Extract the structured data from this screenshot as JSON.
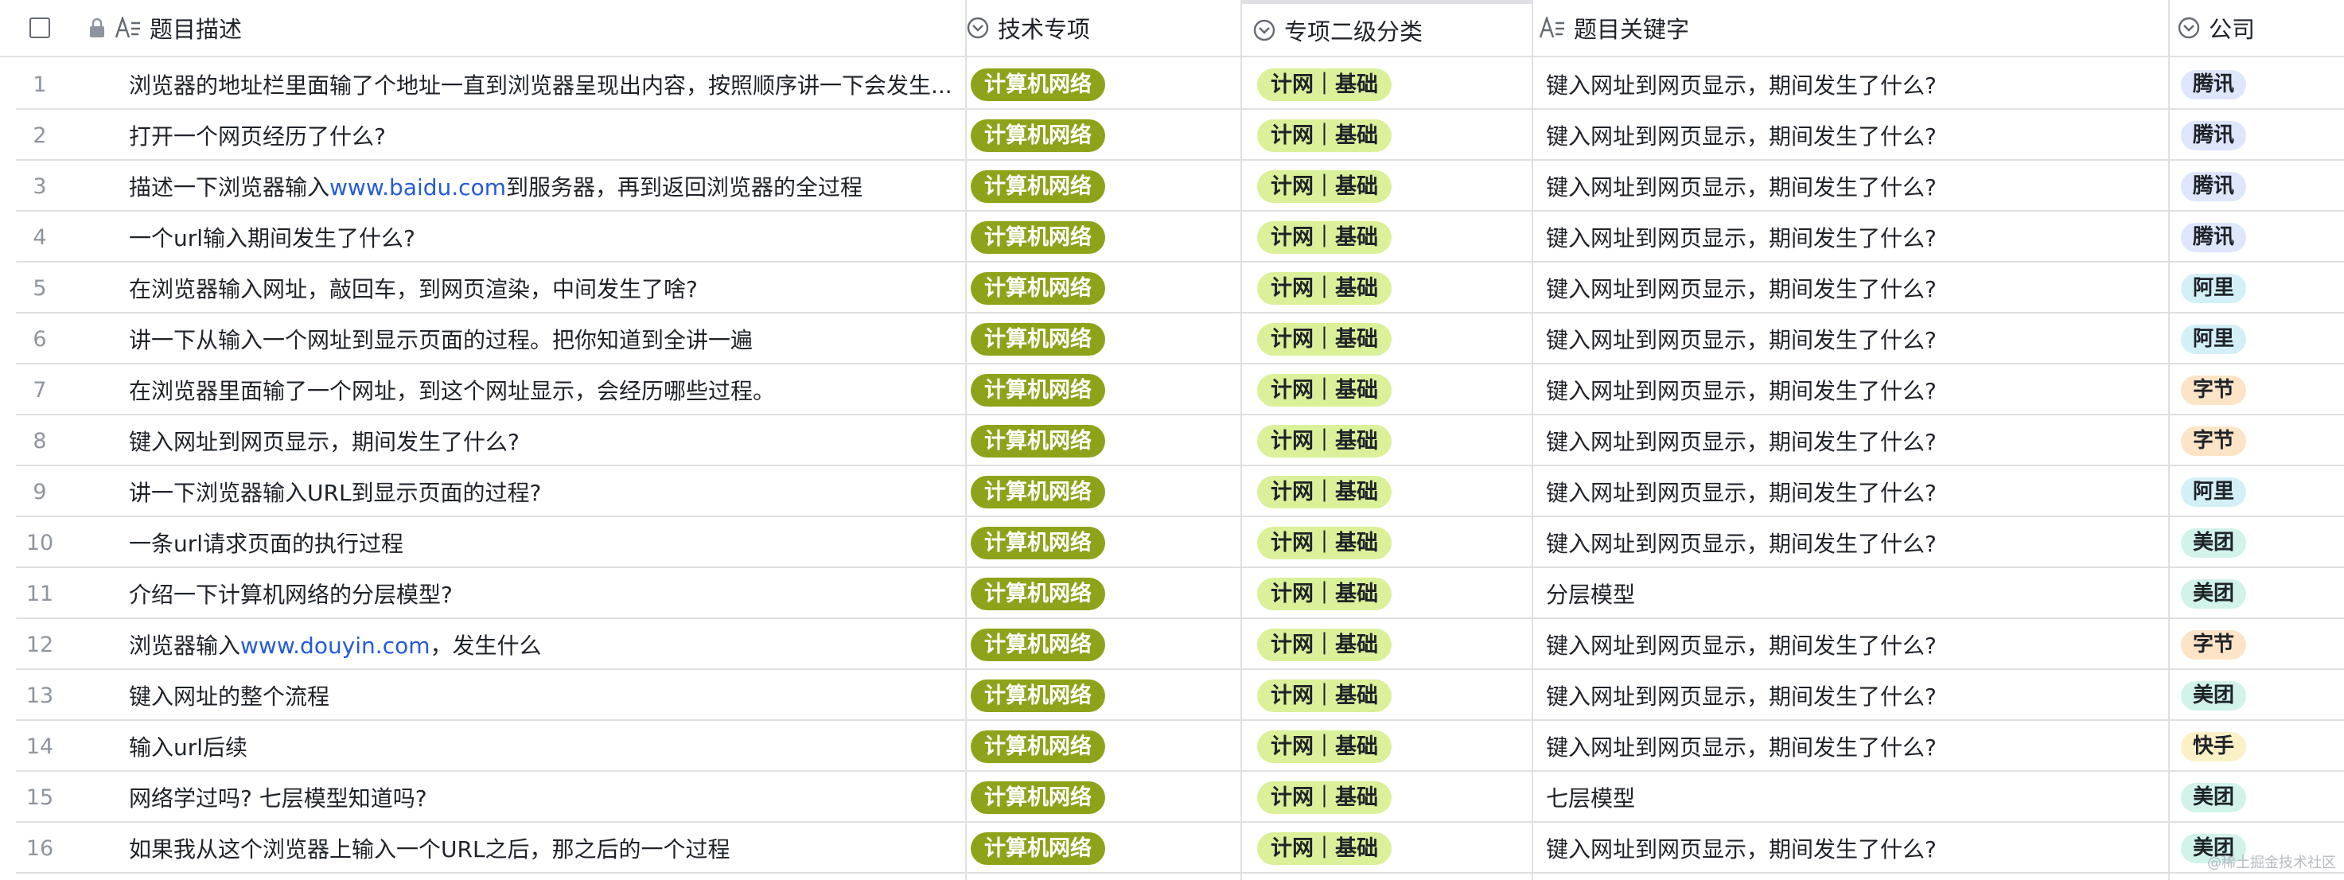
{
  "columns": {
    "title": "题目描述",
    "tech": "技术专项",
    "sub": "专项二级分类",
    "keyword": "题目关键字",
    "company": "公司"
  },
  "icons": {
    "checkbox": "checkbox-icon",
    "lock": "lock-icon",
    "text_field": "text-field-icon",
    "single_select": "single-select-icon"
  },
  "colors": {
    "tech_tag": "#8fa31a",
    "sub_tag": "#dbf199",
    "company_tencent": "#dde6fb",
    "company_ali": "#d3f0f8",
    "company_bytedance": "#fde4c7",
    "company_meituan": "#d1f3ea",
    "company_kuaishou": "#fcf1c6",
    "link": "#245bdb"
  },
  "rows": [
    {
      "index": "1",
      "title": "浏览器的地址栏里面输了个地址一直到浏览器呈现出内容，按照顺序讲一下会发生...",
      "tech": "计算机网络",
      "sub": "计网｜基础",
      "keyword": "键入网址到网页显示，期间发生了什么?",
      "company": "腾讯",
      "company_color": "#dde6fb"
    },
    {
      "index": "2",
      "title": "打开一个网页经历了什么?",
      "tech": "计算机网络",
      "sub": "计网｜基础",
      "keyword": "键入网址到网页显示，期间发生了什么?",
      "company": "腾讯",
      "company_color": "#dde6fb"
    },
    {
      "index": "3",
      "title_pre": "描述一下浏览器输入",
      "title_link": "www.baidu.com",
      "title_post": "到服务器，再到返回浏览器的全过程",
      "tech": "计算机网络",
      "sub": "计网｜基础",
      "keyword": "键入网址到网页显示，期间发生了什么?",
      "company": "腾讯",
      "company_color": "#dde6fb"
    },
    {
      "index": "4",
      "title": "一个url输入期间发生了什么?",
      "tech": "计算机网络",
      "sub": "计网｜基础",
      "keyword": "键入网址到网页显示，期间发生了什么?",
      "company": "腾讯",
      "company_color": "#dde6fb"
    },
    {
      "index": "5",
      "title": "在浏览器输入网址，敲回车，到网页渲染，中间发生了啥?",
      "tech": "计算机网络",
      "sub": "计网｜基础",
      "keyword": "键入网址到网页显示，期间发生了什么?",
      "company": "阿里",
      "company_color": "#d3f0f8"
    },
    {
      "index": "6",
      "title": "讲一下从输入一个网址到显示页面的过程。把你知道到全讲一遍",
      "tech": "计算机网络",
      "sub": "计网｜基础",
      "keyword": "键入网址到网页显示，期间发生了什么?",
      "company": "阿里",
      "company_color": "#d3f0f8"
    },
    {
      "index": "7",
      "title": "在浏览器里面输了一个网址，到这个网址显示，会经历哪些过程。",
      "tech": "计算机网络",
      "sub": "计网｜基础",
      "keyword": "键入网址到网页显示，期间发生了什么?",
      "company": "字节",
      "company_color": "#fde4c7"
    },
    {
      "index": "8",
      "title": "键入网址到网页显示，期间发生了什么?",
      "tech": "计算机网络",
      "sub": "计网｜基础",
      "keyword": "键入网址到网页显示，期间发生了什么?",
      "company": "字节",
      "company_color": "#fde4c7"
    },
    {
      "index": "9",
      "title": "讲一下浏览器输入URL到显示页面的过程?",
      "tech": "计算机网络",
      "sub": "计网｜基础",
      "keyword": "键入网址到网页显示，期间发生了什么?",
      "company": "阿里",
      "company_color": "#d3f0f8"
    },
    {
      "index": "10",
      "title": "一条url请求页面的执行过程",
      "tech": "计算机网络",
      "sub": "计网｜基础",
      "keyword": "键入网址到网页显示，期间发生了什么?",
      "company": "美团",
      "company_color": "#d1f3ea"
    },
    {
      "index": "11",
      "title": "介绍一下计算机网络的分层模型?",
      "tech": "计算机网络",
      "sub": "计网｜基础",
      "keyword": "分层模型",
      "company": "美团",
      "company_color": "#d1f3ea"
    },
    {
      "index": "12",
      "title_pre": "浏览器输入",
      "title_link": "www.douyin.com",
      "title_post": "，发生什么",
      "tech": "计算机网络",
      "sub": "计网｜基础",
      "keyword": "键入网址到网页显示，期间发生了什么?",
      "company": "字节",
      "company_color": "#fde4c7"
    },
    {
      "index": "13",
      "title": "键入网址的整个流程",
      "tech": "计算机网络",
      "sub": "计网｜基础",
      "keyword": "键入网址到网页显示，期间发生了什么?",
      "company": "美团",
      "company_color": "#d1f3ea"
    },
    {
      "index": "14",
      "title": "输入url后续",
      "tech": "计算机网络",
      "sub": "计网｜基础",
      "keyword": "键入网址到网页显示，期间发生了什么?",
      "company": "快手",
      "company_color": "#fcf1c6"
    },
    {
      "index": "15",
      "title": "网络学过吗? 七层模型知道吗?",
      "tech": "计算机网络",
      "sub": "计网｜基础",
      "keyword": "七层模型",
      "company": "美团",
      "company_color": "#d1f3ea"
    },
    {
      "index": "16",
      "title": "如果我从这个浏览器上输入一个URL之后，那之后的一个过程",
      "tech": "计算机网络",
      "sub": "计网｜基础",
      "keyword": "键入网址到网页显示，期间发生了什么?",
      "company": "美团",
      "company_color": "#d1f3ea"
    }
  ],
  "watermark": "@稀土掘金技术社区"
}
